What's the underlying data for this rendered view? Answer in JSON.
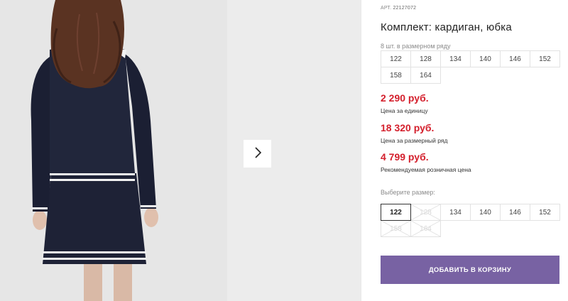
{
  "gallery": {
    "next_icon": "chevron-right-icon"
  },
  "product": {
    "sku_label": "АРТ.",
    "sku_value": "22127072",
    "title": "Комплект: кардиган, юбка",
    "size_row_caption": "8 шт. в размерном ряду",
    "size_row": [
      "122",
      "128",
      "134",
      "140",
      "146",
      "152",
      "158",
      "164"
    ],
    "prices": [
      {
        "value": "2 290 руб.",
        "label": "Цена за единицу"
      },
      {
        "value": "18 320 руб.",
        "label": "Цена за размерный ряд"
      },
      {
        "value": "4 799 руб.",
        "label": "Рекомендуемая розничная цена"
      }
    ],
    "choose_size_caption": "Выберите размер:",
    "sizes": [
      {
        "label": "122",
        "state": "selected"
      },
      {
        "label": "128",
        "state": "unavailable"
      },
      {
        "label": "134",
        "state": "available"
      },
      {
        "label": "140",
        "state": "available"
      },
      {
        "label": "146",
        "state": "available"
      },
      {
        "label": "152",
        "state": "available"
      },
      {
        "label": "158",
        "state": "unavailable"
      },
      {
        "label": "164",
        "state": "unavailable"
      }
    ],
    "add_to_cart_label": "ДОБАВИТЬ В КОРЗИНУ"
  },
  "colors": {
    "price": "#d4202d",
    "button": "#7862a3",
    "garment": "#1e2236"
  }
}
